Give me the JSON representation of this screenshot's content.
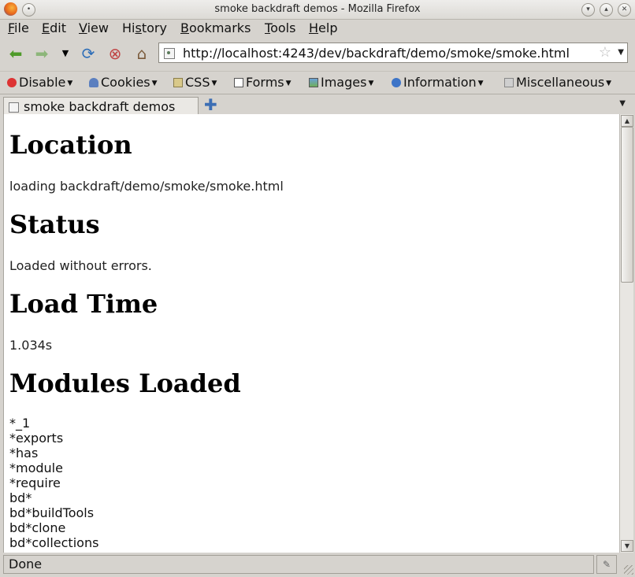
{
  "window": {
    "title": "smoke backdraft demos - Mozilla Firefox"
  },
  "menubar": {
    "items": [
      {
        "label": "File",
        "accel": "F",
        "rest": "ile"
      },
      {
        "label": "Edit",
        "accel": "E",
        "rest": "dit"
      },
      {
        "label": "View",
        "accel": "V",
        "rest": "iew"
      },
      {
        "label": "History",
        "pre": "Hi",
        "accel": "s",
        "rest": "tory"
      },
      {
        "label": "Bookmarks",
        "accel": "B",
        "rest": "ookmarks"
      },
      {
        "label": "Tools",
        "accel": "T",
        "rest": "ools"
      },
      {
        "label": "Help",
        "accel": "H",
        "rest": "elp"
      }
    ]
  },
  "navbar": {
    "url": "http://localhost:4243/dev/backdraft/demo/smoke/smoke.html",
    "icons": [
      "back-icon",
      "forward-icon",
      "history-dropdown-icon",
      "reload-icon",
      "stop-icon",
      "home-icon"
    ]
  },
  "devtoolbar": {
    "items": [
      "Disable",
      "Cookies",
      "CSS",
      "Forms",
      "Images",
      "Information",
      "Miscellaneous"
    ]
  },
  "tabs": [
    {
      "label": "smoke backdraft demos",
      "active": true
    }
  ],
  "content": {
    "location_heading": "Location",
    "location_text": "loading backdraft/demo/smoke/smoke.html",
    "status_heading": "Status",
    "status_text": "Loaded without errors.",
    "loadtime_heading": "Load Time",
    "loadtime_text": "1.034s",
    "modules_heading": "Modules Loaded",
    "modules": [
      "*_1",
      "*exports",
      "*has",
      "*module",
      "*require",
      "bd*",
      "bd*buildTools",
      "bd*clone",
      "bd*collections"
    ]
  },
  "statusbar": {
    "text": "Done"
  },
  "colors": {
    "chrome": "#d6d3ce",
    "page": "#ffffff"
  }
}
